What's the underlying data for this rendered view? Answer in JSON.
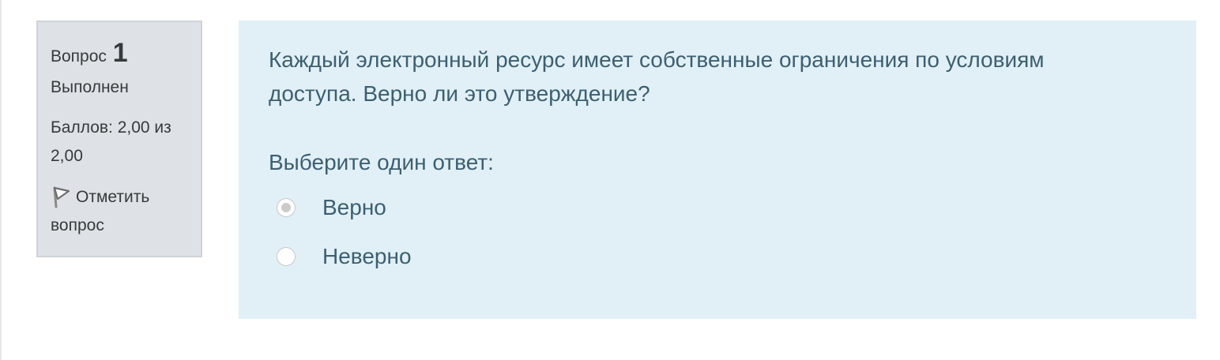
{
  "question_info": {
    "label": "Вопрос",
    "number": "1",
    "state": "Выполнен",
    "grade_line1": "Баллов: 2,00 из",
    "grade_line2": "2,00",
    "flag_line1": "Отметить",
    "flag_line2": "вопрос",
    "flag_icon": "flag-icon"
  },
  "question": {
    "text_line1": "Каждый электронный ресурс имеет собственные ограничения по условиям",
    "text_line2": "доступа. Верно ли это утверждение?",
    "prompt": "Выберите один ответ:",
    "options": [
      {
        "label": "Верно",
        "selected": true
      },
      {
        "label": "Неверно",
        "selected": false
      }
    ]
  },
  "colors": {
    "info_background": "#dee2e6",
    "content_background": "#e1f0f7",
    "text_primary": "#3d5f71",
    "text_info": "#373a3c"
  }
}
